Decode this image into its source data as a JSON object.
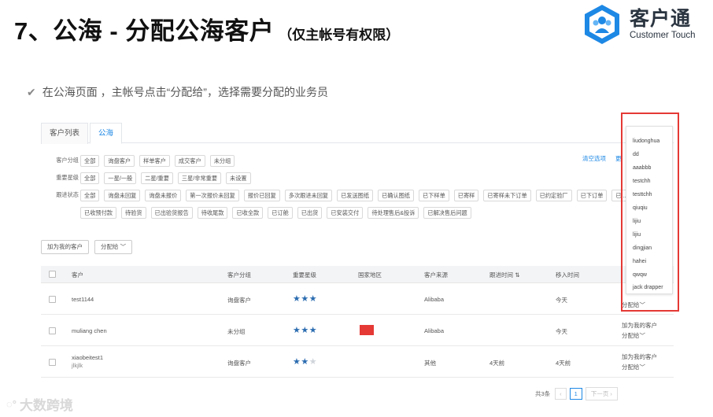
{
  "slide": {
    "title": "7、公海 - 分配公海客户",
    "subtitle": "（仅主帐号有权限）",
    "instruction": "在公海页面 ，主帐号点击“分配给”，选择需要分配的业务员"
  },
  "logo": {
    "cn": "客户通",
    "en": "Customer Touch"
  },
  "tabs": [
    "客户列表",
    "公海"
  ],
  "filters": {
    "group_label": "客户分组",
    "group": [
      "全部",
      "询盘客户",
      "样单客户",
      "成交客户",
      "未分组"
    ],
    "star_label": "重要星级",
    "star": [
      "全部",
      "一星/一般",
      "二星/重要",
      "三星/非常重要",
      "未设置"
    ],
    "status_label": "跟进状态",
    "status_row1": [
      "全部",
      "询盘未回复",
      "询盘未报价",
      "第一次报价未回复",
      "报价已回复",
      "多次跟进未回复",
      "已发送图纸",
      "已确认图纸",
      "已下样单",
      "已寄样",
      "已寄样未下订单",
      "已约定验厂",
      "已下订单",
      "已..."
    ],
    "status_row2": [
      "已收预付款",
      "待验货",
      "已出验货报告",
      "待收尾款",
      "已收全款",
      "已订舱",
      "已出货",
      "已安装交付",
      "待处理售后&投诉",
      "已解决售后问题"
    ],
    "clear": "清空选项",
    "more": "更"
  },
  "actions": {
    "add_mine": "加为我的客户",
    "assign": "分配给"
  },
  "table": {
    "headers": [
      "客户",
      "客户分组",
      "重要星级",
      "国家地区",
      "客户来源",
      "跟进时间",
      "移入时间"
    ],
    "sort_icon": "sort-icon",
    "rows": [
      {
        "name": "test1144",
        "sub": "",
        "group": "询盘客户",
        "stars": 3,
        "flag": false,
        "source": "Alibaba",
        "follow": "",
        "moved": "今天",
        "op1": "",
        "op2": "分配给"
      },
      {
        "name": "muliang chen",
        "sub": "",
        "group": "未分组",
        "stars": 3,
        "flag": true,
        "source": "Alibaba",
        "follow": "",
        "moved": "今天",
        "op1": "加为我的客户",
        "op2": "分配给"
      },
      {
        "name": "xiaobeitest1",
        "sub": "jlkjlk",
        "group": "询盘客户",
        "stars": 2,
        "flag": false,
        "source": "其他",
        "follow": "4天前",
        "moved": "4天前",
        "op1": "加为我的客户",
        "op2": "分配给"
      }
    ]
  },
  "pager": {
    "total": "共3条",
    "page": "1",
    "next": "下一页"
  },
  "dropdown": [
    "liudonghua",
    "dd",
    "aaabbb",
    "testchh",
    "testtchh",
    "qiuqiu",
    "lijiu",
    "lijiu",
    "dingjian",
    "hahei",
    "qwqw",
    "jack drapper"
  ],
  "watermark": "大数跨境",
  "colors": {
    "accent": "#1e88e5",
    "highlight": "#e53935",
    "star": "#2b6cb0"
  }
}
